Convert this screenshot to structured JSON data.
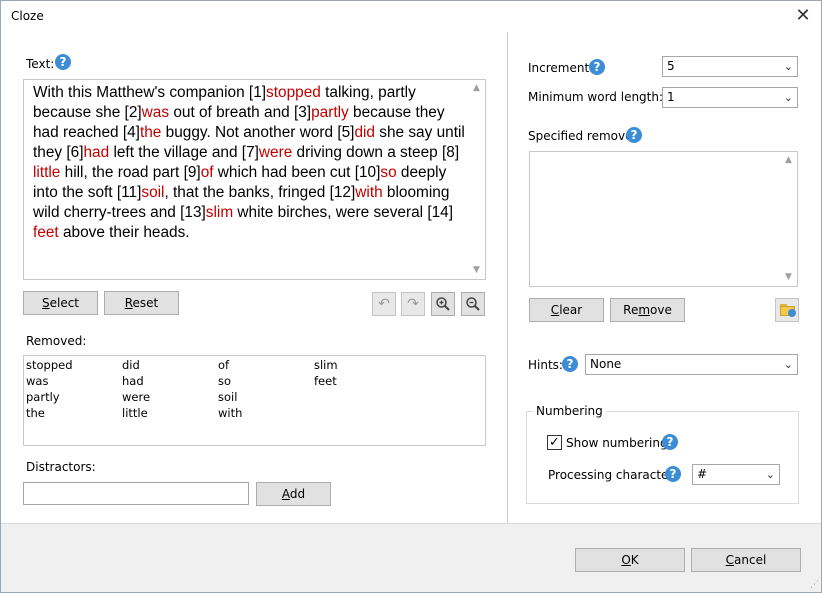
{
  "window": {
    "title": "Cloze",
    "close_glyph": "✕"
  },
  "text_section": {
    "label": "Text:",
    "segments": [
      {
        "t": "With this Matthew's companion [1]",
        "red": false
      },
      {
        "t": "stopped",
        "red": true
      },
      {
        "t": " talking, partly because she [2]",
        "red": false
      },
      {
        "t": "was",
        "red": true
      },
      {
        "t": " out of breath and [3]",
        "red": false
      },
      {
        "t": "partly",
        "red": true
      },
      {
        "t": " because they had reached [4]",
        "red": false
      },
      {
        "t": "the",
        "red": true
      },
      {
        "t": " buggy. Not another word [5]",
        "red": false
      },
      {
        "t": "did",
        "red": true
      },
      {
        "t": " she say until they [6]",
        "red": false
      },
      {
        "t": "had",
        "red": true
      },
      {
        "t": " left the village and [7]",
        "red": false
      },
      {
        "t": "were",
        "red": true
      },
      {
        "t": " driving down a steep [8] ",
        "red": false
      },
      {
        "t": "little",
        "red": true
      },
      {
        "t": " hill, the road part [9]",
        "red": false
      },
      {
        "t": "of",
        "red": true
      },
      {
        "t": " which had been cut [10]",
        "red": false
      },
      {
        "t": "so",
        "red": true
      },
      {
        "t": " deeply into the soft [11]",
        "red": false
      },
      {
        "t": "soil",
        "red": true
      },
      {
        "t": ", that the banks, fringed [12]",
        "red": false
      },
      {
        "t": "with",
        "red": true
      },
      {
        "t": " blooming wild cherry-trees and [13]",
        "red": false
      },
      {
        "t": "slim",
        "red": true
      },
      {
        "t": " white birches, were several [14] ",
        "red": false
      },
      {
        "t": "feet",
        "red": true
      },
      {
        "t": " above their heads.",
        "red": false
      }
    ],
    "highlight_color": "#c00000"
  },
  "buttons": {
    "select": "Select",
    "reset": "Reset",
    "add": "Add",
    "clear": "Clear",
    "remove": "Remove",
    "ok": "OK",
    "cancel": "Cancel"
  },
  "toolbar_icons": [
    "undo-icon",
    "redo-icon",
    "zoom-in-icon",
    "zoom-out-icon"
  ],
  "removed": {
    "label": "Removed:",
    "columns": [
      [
        "stopped",
        "was",
        "partly",
        "the"
      ],
      [
        "did",
        "had",
        "were",
        "little"
      ],
      [
        "of",
        "so",
        "soil",
        "with"
      ],
      [
        "slim",
        "feet"
      ]
    ]
  },
  "distractors": {
    "label": "Distractors:",
    "value": ""
  },
  "increment": {
    "label": "Increment:",
    "value": "5"
  },
  "min_word_length": {
    "label": "Minimum word length:",
    "value": "1"
  },
  "specified_remove": {
    "label": "Specified remove:",
    "value": ""
  },
  "hints": {
    "label": "Hints:",
    "value": "None"
  },
  "numbering": {
    "legend": "Numbering",
    "show_label": "Show numbering",
    "show_checked": true,
    "proc_label": "Processing character:",
    "proc_value": "#"
  },
  "help_glyph": "?"
}
